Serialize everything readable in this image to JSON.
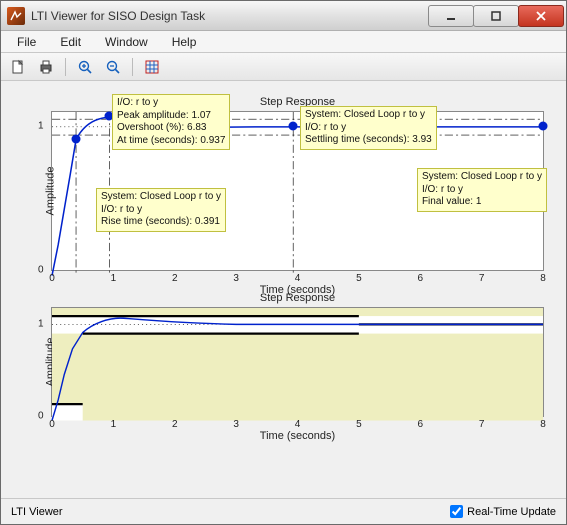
{
  "window": {
    "title": "LTI Viewer for SISO Design Task"
  },
  "menu": {
    "items": [
      "File",
      "Edit",
      "Window",
      "Help"
    ]
  },
  "toolbar": {
    "icons": [
      "new-doc-icon",
      "print-icon",
      "zoom-in-icon",
      "zoom-out-icon",
      "grid-icon"
    ]
  },
  "plot1": {
    "title": "Step Response",
    "xlabel": "Time (seconds)",
    "ylabel": "Amplitude",
    "xticks": [
      0,
      1,
      2,
      3,
      4,
      5,
      6,
      7,
      8
    ],
    "yticks": [
      0,
      1
    ],
    "tooltips": {
      "peak": {
        "l1": "I/O: r to y",
        "l2": "Peak amplitude: 1.07",
        "l3": "Overshoot (%): 6.83",
        "l4": "At time (seconds): 0.937"
      },
      "settling": {
        "l1": "System: Closed Loop r to y",
        "l2": "I/O: r to y",
        "l3": "Settling time (seconds): 3.93"
      },
      "rise": {
        "l1": "System: Closed Loop r to y",
        "l2": "I/O: r to y",
        "l3": "Rise time (seconds): 0.391"
      },
      "final": {
        "l1": "System: Closed Loop r to y",
        "l2": "I/O: r to y",
        "l3": "Final value: 1"
      }
    }
  },
  "plot2": {
    "title": "Step Response",
    "xlabel": "Time (seconds)",
    "ylabel": "Amplitude",
    "xticks": [
      0,
      1,
      2,
      3,
      4,
      5,
      6,
      7,
      8
    ],
    "yticks": [
      0,
      1
    ]
  },
  "statusbar": {
    "text": "LTI Viewer",
    "checkbox_label": "Real-Time Update",
    "checkbox_checked": true
  },
  "chart_data": [
    {
      "type": "line",
      "title": "Step Response",
      "xlabel": "Time (seconds)",
      "ylabel": "Amplitude",
      "xlim": [
        0,
        8
      ],
      "ylim": [
        0,
        1.1
      ],
      "series": [
        {
          "name": "Closed Loop r to y",
          "x": [
            0,
            0.1,
            0.2,
            0.3,
            0.391,
            0.5,
            0.7,
            0.937,
            1.2,
            1.6,
            2.0,
            2.5,
            3.0,
            3.5,
            3.93,
            4.5,
            5,
            6,
            7,
            8
          ],
          "y": [
            0,
            0.2,
            0.5,
            0.78,
            0.9,
            0.97,
            1.04,
            1.07,
            1.05,
            1.02,
            1.0,
            0.995,
            1.0,
            1.0,
            1.0,
            1.0,
            1.0,
            1.0,
            1.0,
            1.0
          ]
        }
      ],
      "annotations": {
        "rise_time_s": 0.391,
        "peak_amplitude": 1.07,
        "overshoot_pct": 6.83,
        "peak_time_s": 0.937,
        "settling_time_s": 3.93,
        "final_value": 1.0
      }
    },
    {
      "type": "line",
      "title": "Step Response",
      "xlabel": "Time (seconds)",
      "ylabel": "Amplitude",
      "xlim": [
        0,
        8
      ],
      "ylim": [
        0,
        1.1
      ],
      "series": [
        {
          "name": "Closed Loop r to y",
          "x": [
            0,
            0.1,
            0.2,
            0.3,
            0.4,
            0.6,
            0.8,
            1.0,
            1.3,
            1.7,
            2.2,
            3.0,
            4.0,
            5.0,
            6.0,
            7.0,
            8.0
          ],
          "y": [
            0,
            0.2,
            0.48,
            0.72,
            0.86,
            1.0,
            1.06,
            1.07,
            1.05,
            1.02,
            1.0,
            0.99,
            1.0,
            1.0,
            1.0,
            1.0,
            1.0
          ]
        }
      ],
      "bounds": {
        "upper": 1.2,
        "lower": 0.8,
        "settling_lower_start_x": 0.5,
        "settling_upper_end_x": 5.0
      }
    }
  ]
}
